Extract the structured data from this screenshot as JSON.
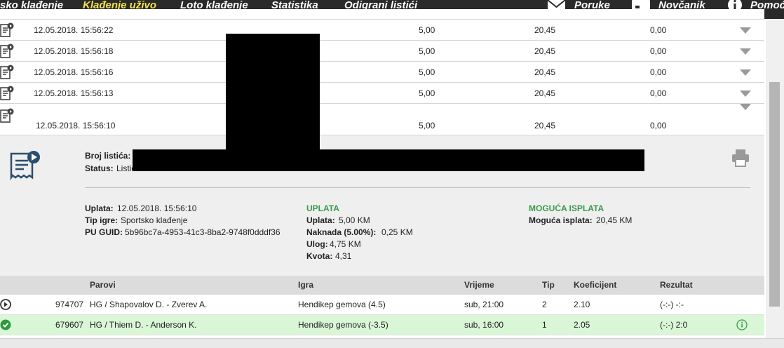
{
  "nav": {
    "items": [
      {
        "label": "sko klađenje",
        "active": false
      },
      {
        "label": "Klađenje uživo",
        "active": true
      },
      {
        "label": "Loto klađenje",
        "active": false
      },
      {
        "label": "Statistika",
        "active": false
      },
      {
        "label": "Odigrani listići",
        "active": false
      }
    ],
    "messages": "Poruke",
    "wallet": "Novčanik",
    "help": "Pomoć"
  },
  "tickets": [
    {
      "datetime": "12.05.2018. 15:56:22",
      "stake": "5,00",
      "possible": "20,45",
      "win": "0,00"
    },
    {
      "datetime": "12.05.2018. 15:56:18",
      "stake": "5,00",
      "possible": "20,45",
      "win": "0,00"
    },
    {
      "datetime": "12.05.2018. 15:56:16",
      "stake": "5,00",
      "possible": "20,45",
      "win": "0,00"
    },
    {
      "datetime": "12.05.2018. 15:56:13",
      "stake": "5,00",
      "possible": "20,45",
      "win": "0,00"
    },
    {
      "datetime": "12.05.2018. 15:56:10",
      "stake": "5,00",
      "possible": "20,45",
      "win": "0,00"
    }
  ],
  "detail": {
    "ticket_no_label": "Broj listića:",
    "status_label": "Status:",
    "status_value": "Listić",
    "payment_label": "Uplata:",
    "payment_value": "12.05.2018. 15:56:10",
    "game_type_label": "Tip igre:",
    "game_type_value": "Sportsko klađenje",
    "guid_label": "PU GUID:",
    "guid_value": "5b96bc7a-4953-41c3-8ba2-9748f0dddf36",
    "uplata_title": "UPLATA",
    "uplata_label": "Uplata:",
    "uplata_value": "5,00 KM",
    "fee_label": "Naknada (5.00%):",
    "fee_value": "0,25 KM",
    "bet_label": "Ulog:",
    "bet_value": "4,75 KM",
    "odds_label": "Kvota:",
    "odds_value": "4,31",
    "payout_title": "MOGUĆA ISPLATA",
    "payout_label": "Moguća isplata:",
    "payout_value": "20,45 KM"
  },
  "pairs_table": {
    "headers": [
      "Parovi",
      "Igra",
      "Vrijeme",
      "Tip",
      "Koeficijent",
      "Rezultat"
    ],
    "rows": [
      {
        "id": "974707",
        "pair": "HG / Shapovalov D. - Zverev A.",
        "game": "Hendikep gemova (4.5)",
        "time": "sub, 21:00",
        "tip": "2",
        "coef": "2.10",
        "result": "(-:-) -:-",
        "status": "pending"
      },
      {
        "id": "679607",
        "pair": "HG / Thiem D. - Anderson K.",
        "game": "Hendikep gemova (-3.5)",
        "time": "sub, 16:00",
        "tip": "1",
        "coef": "2.05",
        "result": "(-:-) 2:0",
        "status": "won"
      }
    ]
  },
  "colors": {
    "accent_yellow": "#f2e34c",
    "green": "#3a9a4a",
    "won_row": "#d9f7d6",
    "nav_bg": "#2a2a2a"
  }
}
